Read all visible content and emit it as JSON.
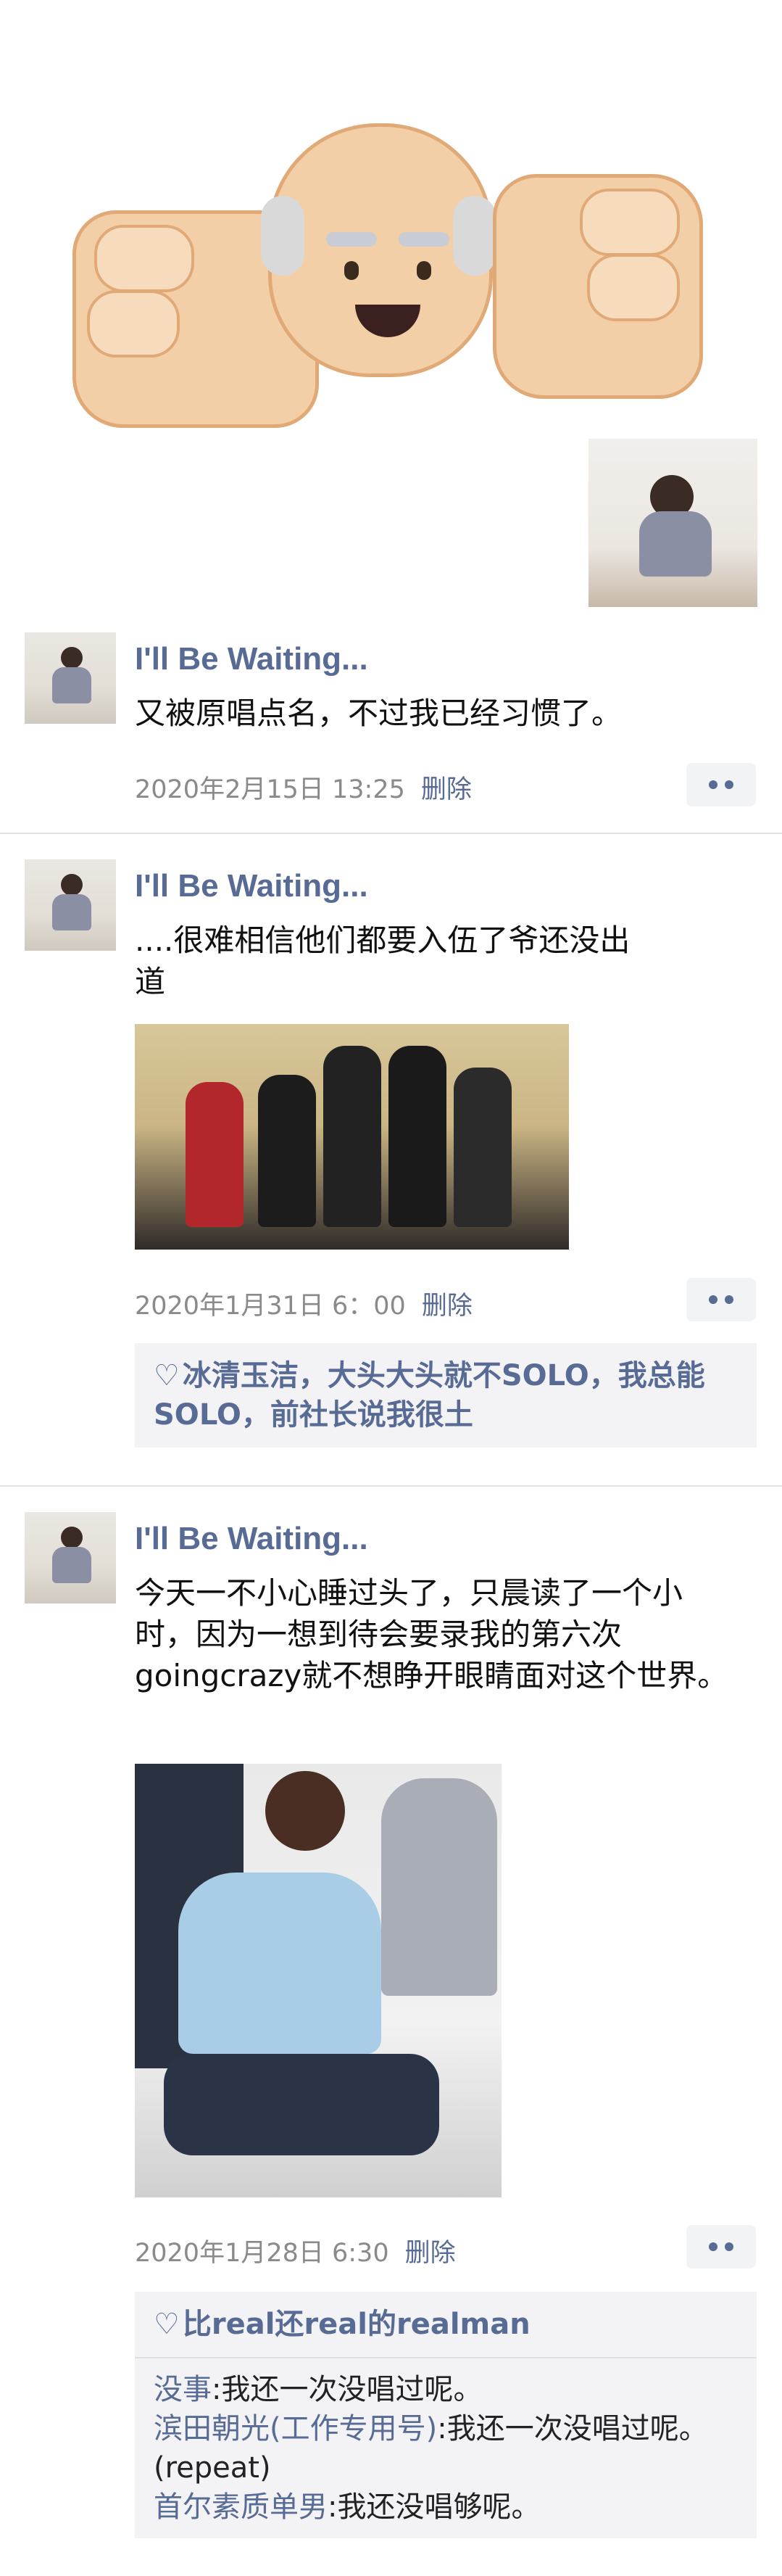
{
  "sticker": {
    "icon": "old-man-fist-bump-emoji"
  },
  "posts": [
    {
      "username": "I'll Be Waiting...",
      "text": "又被原唱点名，不过我已经习惯了。",
      "date": "2020年2月15日 13:25",
      "delete_label": "删除"
    },
    {
      "username": "I'll Be Waiting...",
      "text": "....很难相信他们都要入伍了爷还没出道",
      "date": "2020年1月31日 6：00",
      "delete_label": "删除",
      "likes": "冰清玉洁，大头大头就不SOLO，我总能SOLO，前社长说我很土"
    },
    {
      "username": "I'll Be Waiting...",
      "text": "今天一不小心睡过头了，只晨读了一个小时，因为一想到待会要录我的第六次goingcrazy就不想睁开眼睛面对这个世界。",
      "date": "2020年1月28日 6:30",
      "delete_label": "删除",
      "likes": "比real还real的realman",
      "comments": [
        {
          "author": "没事",
          "sep": ":",
          "text": "我还一次没唱过呢。"
        },
        {
          "author": "滨田朝光(工作专用号)",
          "sep": ":",
          "text": "我还一次没唱过呢。(repeat)"
        },
        {
          "author": "首尔素质单男",
          "sep": ":",
          "text": "我还没唱够呢。"
        }
      ]
    }
  ],
  "colors": {
    "link": "#576b95",
    "meta": "#8a8a8a",
    "box_bg": "#f3f3f5"
  }
}
